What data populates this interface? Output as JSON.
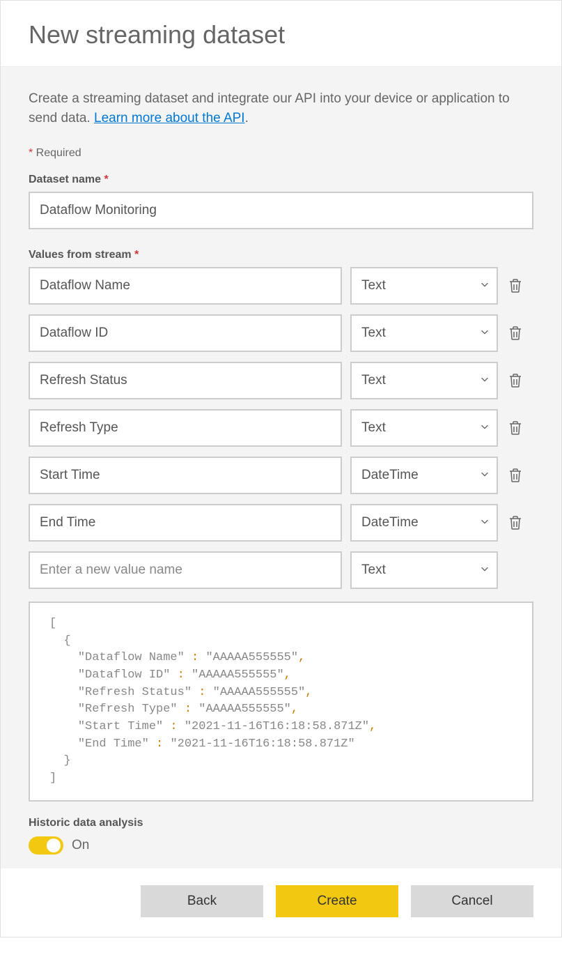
{
  "header": {
    "title": "New streaming dataset"
  },
  "intro": {
    "text_before": "Create a streaming dataset and integrate our API into your device or application to send data. ",
    "link_text": "Learn more about the API",
    "text_after": "."
  },
  "required_note": {
    "star": "*",
    "label": " Required"
  },
  "dataset_name": {
    "label": "Dataset name ",
    "star": "*",
    "value": "Dataflow Monitoring"
  },
  "stream": {
    "label": "Values from stream ",
    "star": "*",
    "rows": [
      {
        "name": "Dataflow Name",
        "type": "Text"
      },
      {
        "name": "Dataflow ID",
        "type": "Text"
      },
      {
        "name": "Refresh Status",
        "type": "Text"
      },
      {
        "name": "Refresh Type",
        "type": "Text"
      },
      {
        "name": "Start Time",
        "type": "DateTime"
      },
      {
        "name": "End Time",
        "type": "DateTime"
      }
    ],
    "new_row": {
      "placeholder": "Enter a new value name",
      "type": "Text"
    }
  },
  "json_preview": {
    "lines": [
      {
        "indent": 0,
        "key": "",
        "val": "",
        "open": "["
      },
      {
        "indent": 1,
        "key": "",
        "val": "",
        "open": "{"
      },
      {
        "indent": 2,
        "key": "Dataflow Name",
        "val": "AAAAA555555",
        "trail": ","
      },
      {
        "indent": 2,
        "key": "Dataflow ID",
        "val": "AAAAA555555",
        "trail": ","
      },
      {
        "indent": 2,
        "key": "Refresh Status",
        "val": "AAAAA555555",
        "trail": ","
      },
      {
        "indent": 2,
        "key": "Refresh Type",
        "val": "AAAAA555555",
        "trail": ","
      },
      {
        "indent": 2,
        "key": "Start Time",
        "val": "2021-11-16T16:18:58.871Z",
        "trail": ","
      },
      {
        "indent": 2,
        "key": "End Time",
        "val": "2021-11-16T16:18:58.871Z",
        "trail": ""
      },
      {
        "indent": 1,
        "key": "",
        "val": "",
        "close": "}"
      },
      {
        "indent": 0,
        "key": "",
        "val": "",
        "close": "]"
      }
    ]
  },
  "historic": {
    "label": "Historic data analysis",
    "state": "On"
  },
  "footer": {
    "back": "Back",
    "create": "Create",
    "cancel": "Cancel"
  }
}
